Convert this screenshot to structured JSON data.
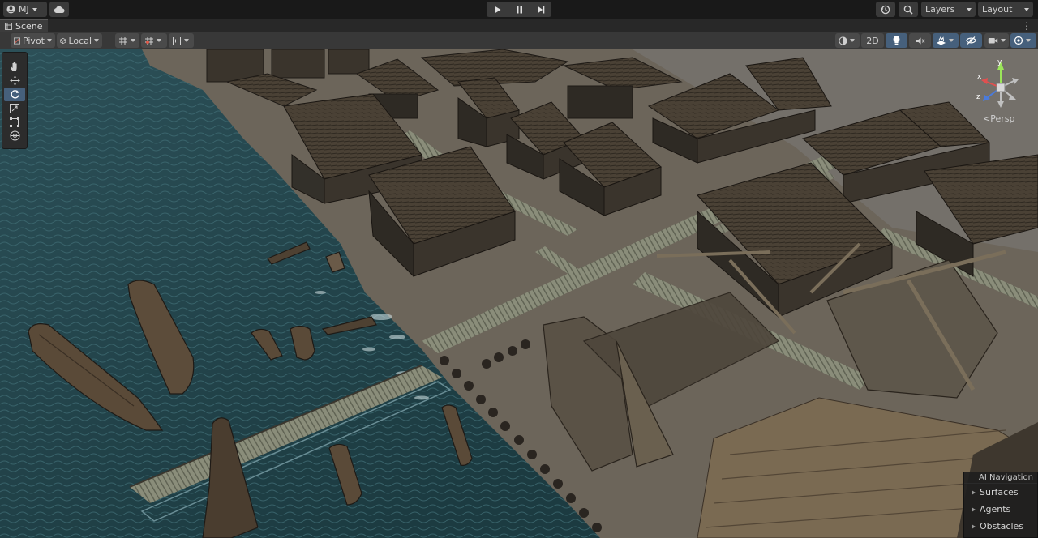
{
  "toolbar": {
    "account_label": "MJ",
    "layers_label": "Layers",
    "layout_label": "Layout"
  },
  "scene_tab": {
    "label": "Scene"
  },
  "scene_toolbar": {
    "pivot_label": "Pivot",
    "local_label": "Local",
    "twod_label": "2D"
  },
  "gizmo": {
    "projection_label": "<Persp",
    "axis_y": "y",
    "axis_x": "x",
    "axis_z": "z"
  },
  "ai_navigation": {
    "title": "AI Navigation",
    "items": [
      "Surfaces",
      "Agents",
      "Obstacles"
    ]
  },
  "colors": {
    "accent_active": "#46607c",
    "toolbar_bg": "#191919",
    "water": "#24474d",
    "ground": "#6c655a"
  },
  "icons": [
    "account-icon",
    "cloud-icon",
    "play-icon",
    "pause-icon",
    "step-icon",
    "history-icon",
    "search-icon",
    "hand-tool-icon",
    "move-tool-icon",
    "rotate-tool-icon",
    "scale-tool-icon",
    "rect-tool-icon",
    "transform-tool-icon",
    "grid-snap-icon",
    "lighting-icon",
    "audio-icon",
    "effects-icon",
    "visibility-icon",
    "camera-icon",
    "gizmos-icon"
  ]
}
